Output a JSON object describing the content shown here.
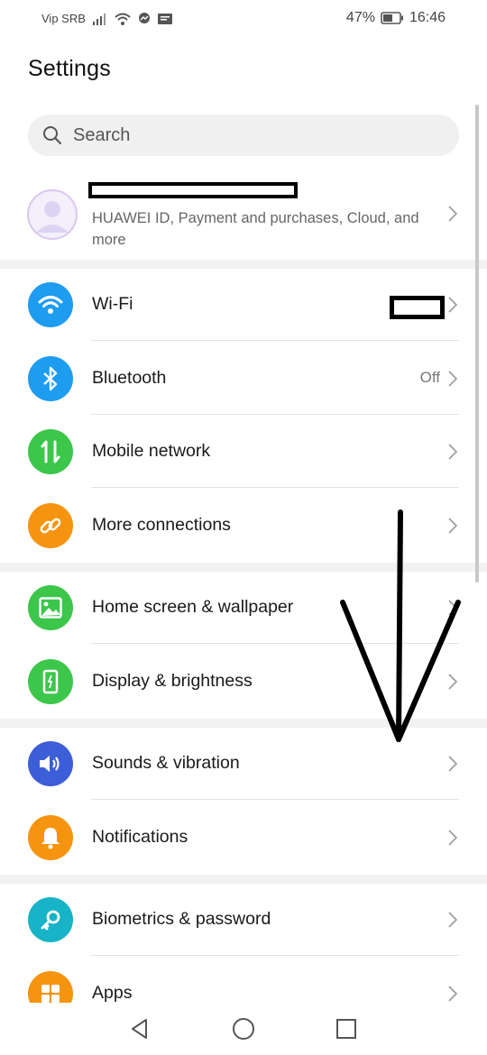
{
  "status_bar": {
    "carrier": "Vip SRB",
    "battery": "47%",
    "time": "16:46"
  },
  "page_title": "Settings",
  "search": {
    "placeholder": "Search"
  },
  "account": {
    "subtitle": "HUAWEI ID, Payment and purchases, Cloud, and more"
  },
  "rows": {
    "wifi": {
      "label": "Wi-Fi",
      "icon": "wifi-icon",
      "color": "#1e9cf0"
    },
    "bluetooth": {
      "label": "Bluetooth",
      "value": "Off",
      "icon": "bluetooth-icon",
      "color": "#1e9cf0"
    },
    "mobile_network": {
      "label": "Mobile network",
      "icon": "mobile-data-icon",
      "color": "#3cc64a"
    },
    "more_connections": {
      "label": "More connections",
      "icon": "link-icon",
      "color": "#f5940f"
    },
    "home_screen": {
      "label": "Home screen & wallpaper",
      "icon": "image-icon",
      "color": "#3cc64a"
    },
    "display": {
      "label": "Display & brightness",
      "icon": "display-icon",
      "color": "#3cc64a"
    },
    "sounds": {
      "label": "Sounds & vibration",
      "icon": "speaker-icon",
      "color": "#3d5ed9"
    },
    "notifications": {
      "label": "Notifications",
      "icon": "bell-icon",
      "color": "#f5940f"
    },
    "biometrics": {
      "label": "Biometrics & password",
      "icon": "key-icon",
      "color": "#17b3c7"
    },
    "apps": {
      "label": "Apps",
      "icon": "apps-grid-icon",
      "color": "#f5940f"
    }
  }
}
